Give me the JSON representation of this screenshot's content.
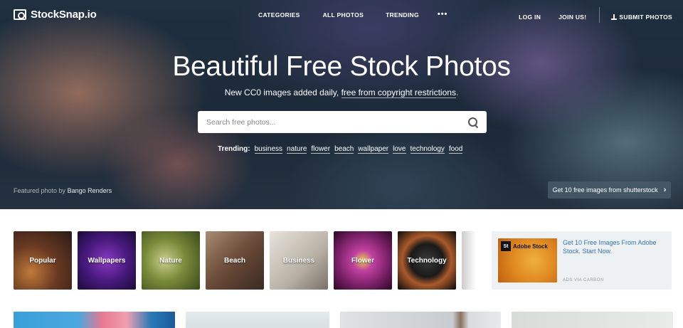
{
  "brand": {
    "name": "StockSnap.io"
  },
  "nav": {
    "center": [
      "CATEGORIES",
      "ALL PHOTOS",
      "TRENDING"
    ],
    "more": "•••",
    "login": "LOG IN",
    "join": "JOIN US!",
    "submit": "SUBMIT PHOTOS"
  },
  "hero": {
    "title": "Beautiful Free Stock Photos",
    "subtitle_prefix": "New CC0 images added daily, ",
    "subtitle_link": "free from copyright restrictions",
    "subtitle_suffix": ".",
    "search_placeholder": "Search free photos...",
    "trending_label": "Trending:",
    "trending_tags": [
      "business",
      "nature",
      "flower",
      "beach",
      "wallpaper",
      "love",
      "technology",
      "food"
    ],
    "featured_prefix": "Featured photo by ",
    "featured_author": "Bango Renders",
    "shutterstock_cta": "Get 10 free images from shutterstock",
    "shutterstock_chevron": "›"
  },
  "categories": [
    "Popular",
    "Wallpapers",
    "Nature",
    "Beach",
    "Business",
    "Flower",
    "Technology"
  ],
  "ad": {
    "logo_box": "St",
    "logo_text": "Adobe Stock",
    "text": "Get 10 Free Images From Adobe Stock. Start Now.",
    "via": "ADS VIA CARBON"
  },
  "colors": {
    "link_blue": "#2e74b5",
    "ad_bg": "#eef1f4"
  }
}
